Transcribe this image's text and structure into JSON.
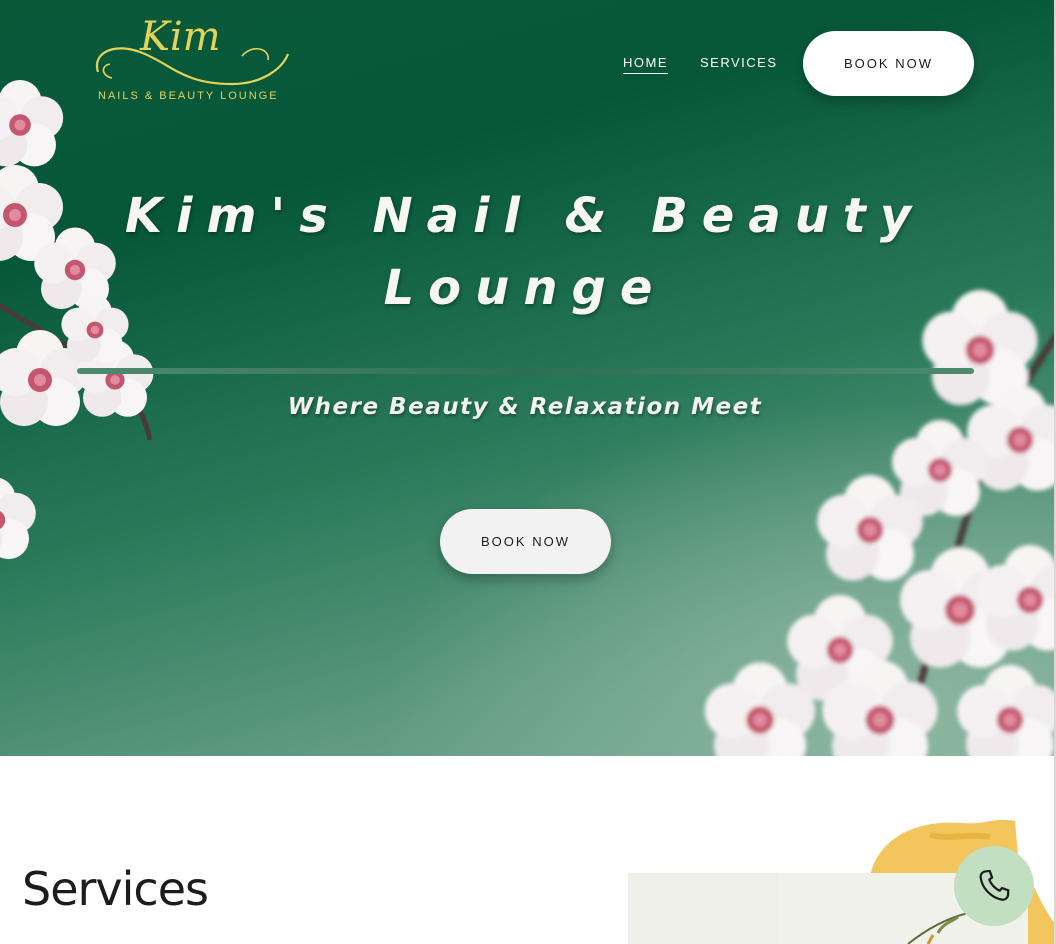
{
  "header": {
    "logo_script": "Kim",
    "logo_tagline": "NAILS & BEAUTY LOUNGE",
    "nav": [
      {
        "label": "HOME",
        "active": true
      },
      {
        "label": "SERVICES",
        "active": false
      }
    ],
    "book_button": "BOOK NOW"
  },
  "hero": {
    "title_line1": "Kim's Nail & Beauty",
    "title_line2": "Lounge",
    "subtitle": "Where Beauty & Relaxation Meet",
    "book_button": "BOOK NOW"
  },
  "services": {
    "heading": "Services"
  },
  "floating": {
    "icon": "phone-icon"
  },
  "colors": {
    "hero_green": "#06573a",
    "logo_gold": "#e4d35a",
    "phone_button": "#c3dfc1",
    "brush_yellow": "#f2c65c"
  }
}
